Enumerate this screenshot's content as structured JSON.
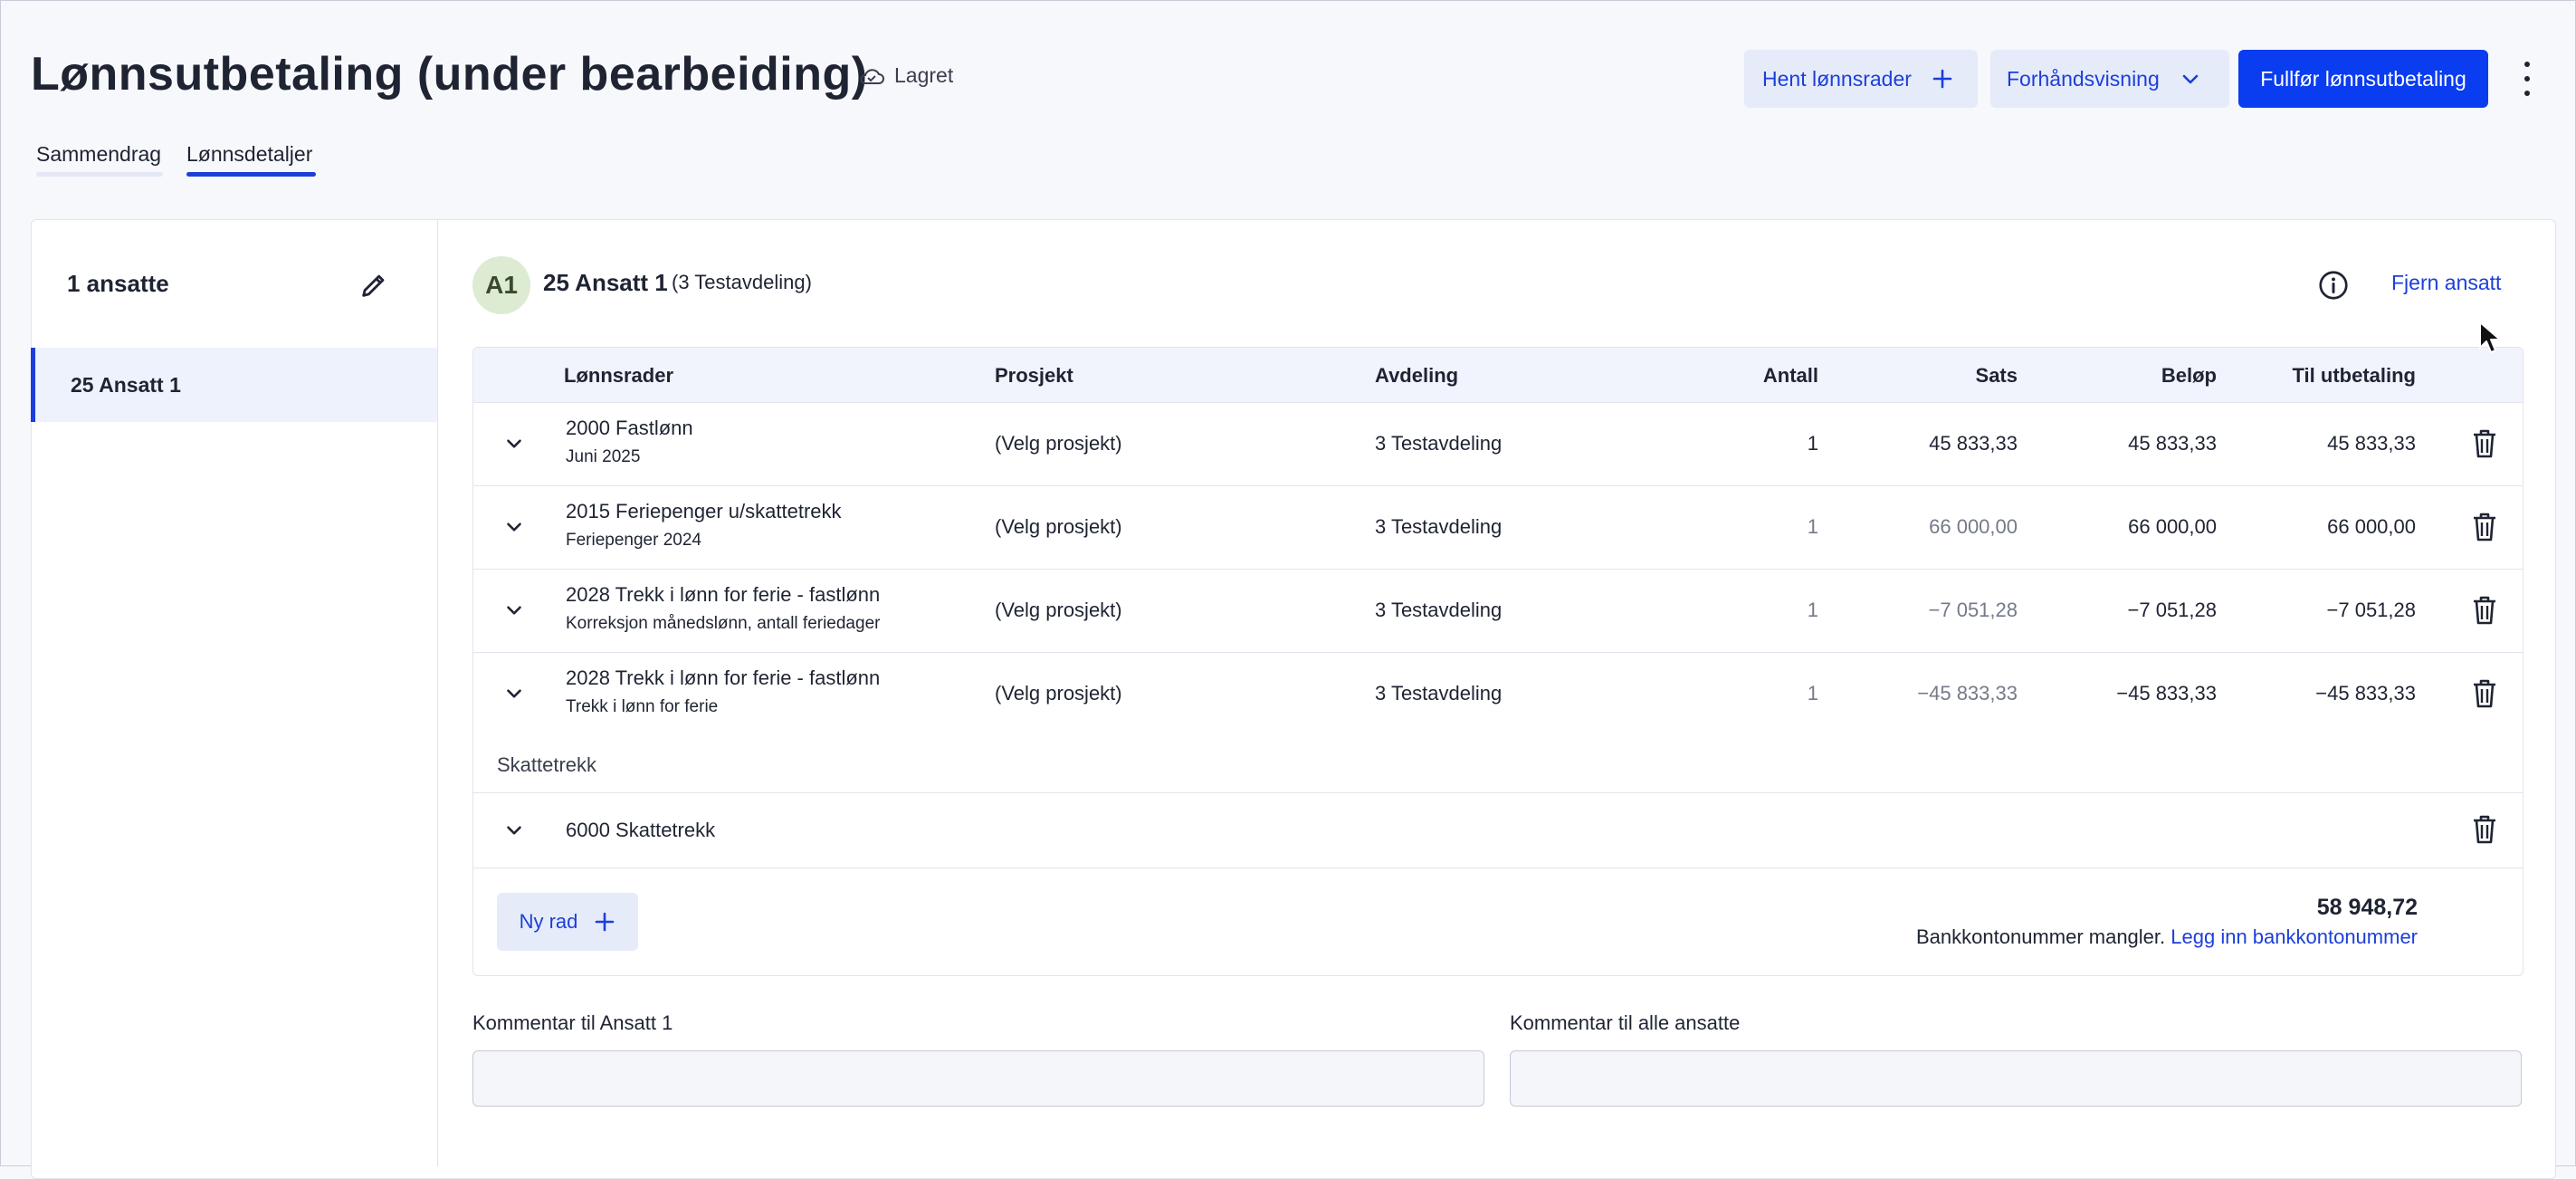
{
  "header": {
    "title": "Lønnsutbetaling (under bearbeiding)",
    "saved_status": "Lagret",
    "fetch_rows_label": "Hent lønnsrader",
    "preview_label": "Forhåndsvisning",
    "complete_label": "Fullfør lønnsutbetaling"
  },
  "tabs": [
    {
      "label": "Sammendrag"
    },
    {
      "label": "Lønnsdetaljer"
    }
  ],
  "sidebar": {
    "title": "1 ansatte",
    "items": [
      {
        "label": "25 Ansatt 1"
      }
    ]
  },
  "employee": {
    "initials": "A1",
    "name": "25 Ansatt 1",
    "department": "(3 Testavdeling)",
    "remove_label": "Fjern ansatt"
  },
  "table": {
    "headers": {
      "lines": "Lønnsrader",
      "project": "Prosjekt",
      "department": "Avdeling",
      "quantity": "Antall",
      "rate": "Sats",
      "amount": "Beløp",
      "payout": "Til utbetaling"
    },
    "rows": [
      {
        "name": "2000 Fastlønn",
        "sub": "Juni 2025",
        "project": "(Velg prosjekt)",
        "department": "3 Testavdeling",
        "quantity": "1",
        "rate": "45 833,33",
        "amount": "45 833,33",
        "payout": "45 833,33"
      },
      {
        "name": "2015 Feriepenger u/skattetrekk",
        "sub": "Feriepenger 2024",
        "project": "(Velg prosjekt)",
        "department": "3 Testavdeling",
        "quantity": "1",
        "rate": "66 000,00",
        "amount": "66 000,00",
        "payout": "66 000,00"
      },
      {
        "name": "2028 Trekk i lønn for ferie - fastlønn",
        "sub": "Korreksjon månedslønn, antall feriedager",
        "project": "(Velg prosjekt)",
        "department": "3 Testavdeling",
        "quantity": "1",
        "rate": "−7 051,28",
        "amount": "−7 051,28",
        "payout": "−7 051,28"
      },
      {
        "name": "2028 Trekk i lønn for ferie - fastlønn",
        "sub": "Trekk i lønn for ferie",
        "project": "(Velg prosjekt)",
        "department": "3 Testavdeling",
        "quantity": "1",
        "rate": "−45 833,33",
        "amount": "−45 833,33",
        "payout": "−45 833,33"
      }
    ],
    "section_label": "Skattetrekk",
    "tax_row": {
      "name": "6000 Skattetrekk"
    },
    "new_row_label": "Ny rad",
    "total": "58 948,72",
    "bank_missing": "Bankkontonummer mangler.",
    "bank_link": "Legg inn bankkontonummer"
  },
  "comments": {
    "employee_label": "Kommentar til Ansatt 1",
    "all_label": "Kommentar til alle ansatte"
  },
  "colors": {
    "accent": "#0a3cf0",
    "link": "#1c3fd9",
    "light_button": "#e6ebfa",
    "avatar_bg": "#dcebd2"
  },
  "icons": [
    "cloud-check-icon",
    "plus-icon",
    "chevron-down-icon",
    "more-vertical-icon",
    "pencil-icon",
    "info-icon",
    "trash-icon",
    "cursor-icon"
  ]
}
